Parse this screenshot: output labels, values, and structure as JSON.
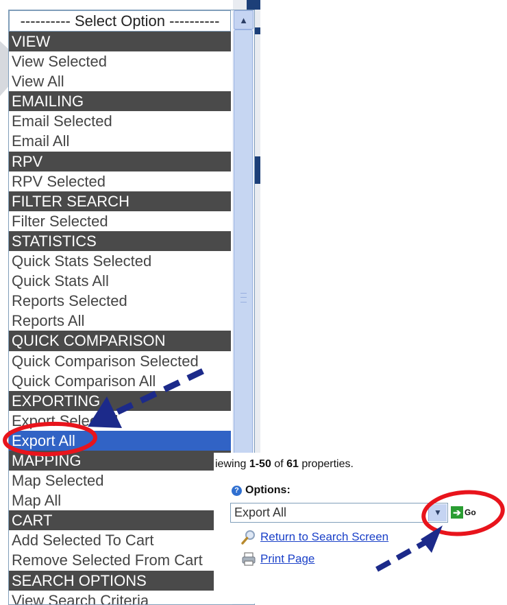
{
  "dropdown": {
    "placeholder": "---------- Select Option ----------",
    "options": [
      {
        "label": "VIEW",
        "header": true
      },
      {
        "label": "View Selected"
      },
      {
        "label": "View All"
      },
      {
        "label": "EMAILING",
        "header": true
      },
      {
        "label": "Email Selected"
      },
      {
        "label": "Email All"
      },
      {
        "label": "RPV",
        "header": true
      },
      {
        "label": "RPV Selected"
      },
      {
        "label": "FILTER SEARCH",
        "header": true
      },
      {
        "label": "Filter Selected"
      },
      {
        "label": "STATISTICS",
        "header": true
      },
      {
        "label": "Quick Stats Selected"
      },
      {
        "label": "Quick Stats All"
      },
      {
        "label": "Reports Selected"
      },
      {
        "label": "Reports All"
      },
      {
        "label": "QUICK COMPARISON",
        "header": true
      },
      {
        "label": "Quick Comparison Selected"
      },
      {
        "label": "Quick Comparison All"
      },
      {
        "label": "EXPORTING",
        "header": true
      },
      {
        "label": "Export Selected"
      },
      {
        "label": "Export All",
        "selected": true
      },
      {
        "label": "MAPPING",
        "header": true
      },
      {
        "label": "Map Selected"
      },
      {
        "label": "Map All"
      },
      {
        "label": "CART",
        "header": true
      },
      {
        "label": "Add Selected To Cart"
      },
      {
        "label": "Remove Selected From Cart"
      },
      {
        "label": "SEARCH OPTIONS",
        "header": true
      },
      {
        "label": "View Search Criteria"
      }
    ]
  },
  "results": {
    "viewing_prefix": "iewing ",
    "range": "1-50",
    "of_text": " of ",
    "total": "61",
    "suffix": " properties."
  },
  "options_panel": {
    "label": "Options:",
    "selected_value": "Export All",
    "go_label": "Go",
    "return_link": "Return to Search Screen",
    "print_link": "Print Page"
  },
  "colors": {
    "header_bg": "#4a4a4a",
    "selected_bg": "#3163c5",
    "link": "#1a40c8",
    "highlight_circle": "#e8141c",
    "arrow": "#1c2a8a"
  }
}
